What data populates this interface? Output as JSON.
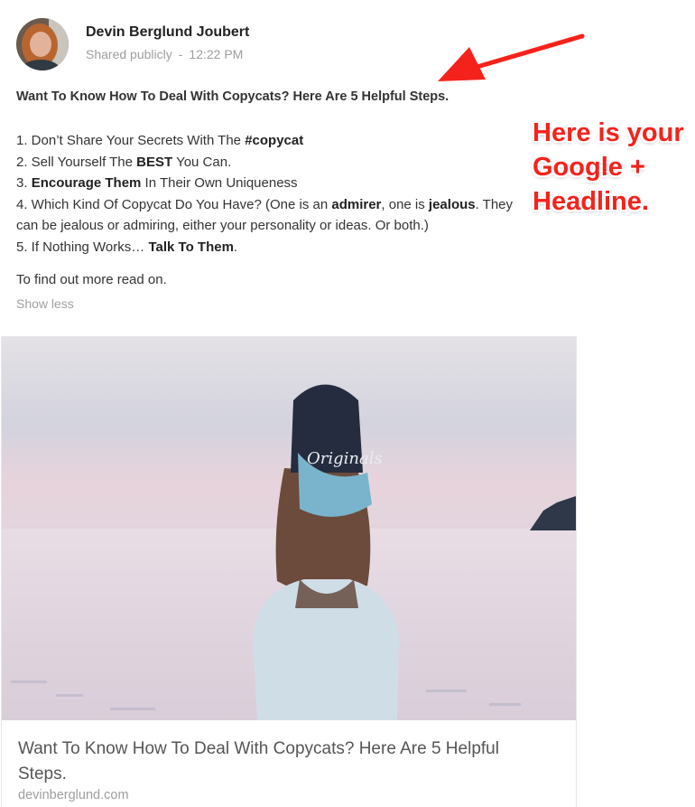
{
  "post": {
    "author": "Devin Berglund Joubert",
    "visibility": "Shared publicly",
    "separator": "-",
    "time": "12:22 PM",
    "headline": "Want To Know How To Deal With Copycats? Here Are 5 Helpful Steps.",
    "steps": [
      {
        "pre": "1. Don’t Share Your Secrets With The ",
        "bold1": "#copycat",
        "mid": "",
        "bold2": "",
        "post": ""
      },
      {
        "pre": "2. Sell Yourself The ",
        "bold1": "BEST",
        "mid": " You Can.",
        "bold2": "",
        "post": ""
      },
      {
        "pre": "3. ",
        "bold1": "Encourage Them",
        "mid": " In Their Own Uniqueness",
        "bold2": "",
        "post": ""
      },
      {
        "pre": "4. Which Kind Of Copycat Do You Have? (One is an ",
        "bold1": "admirer",
        "mid": ", one is ",
        "bold2": "jealous",
        "post": ". They can be jealous or admiring, either your personality or ideas. Or both.)"
      },
      {
        "pre": "5. If Nothing Works… ",
        "bold1": "Talk To Them",
        "mid": ".",
        "bold2": "",
        "post": ""
      }
    ],
    "closing": "To find out more read on.",
    "show_less": "Show less"
  },
  "link_card": {
    "title": "Want To Know How To Deal With Copycats? Here Are 5 Helpful Steps.",
    "domain": "devinberglund.com",
    "image_alt": "Girl in Originals cap looking at the sea"
  },
  "annotation": {
    "lines": [
      "Here is your",
      "Google +",
      "Headline."
    ],
    "color": "#f5221b"
  }
}
